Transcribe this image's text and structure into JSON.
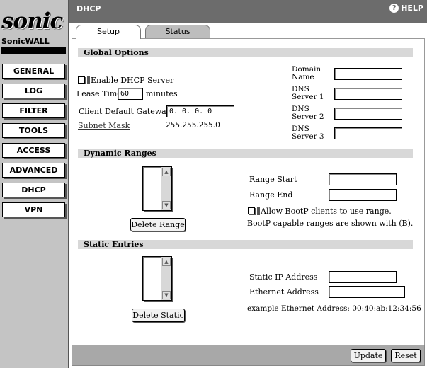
{
  "sidebar": {
    "logo": "sonic",
    "brand": "SonicWALL",
    "items": [
      {
        "id": "general",
        "label": "GENERAL"
      },
      {
        "id": "log",
        "label": "LOG"
      },
      {
        "id": "filter",
        "label": "FILTER"
      },
      {
        "id": "tools",
        "label": "TOOLS"
      },
      {
        "id": "access",
        "label": "ACCESS"
      },
      {
        "id": "advanced",
        "label": "ADVANCED"
      },
      {
        "id": "dhcp",
        "label": "DHCP"
      },
      {
        "id": "vpn",
        "label": "VPN"
      }
    ]
  },
  "header": {
    "title": "DHCP",
    "help_label": "HELP",
    "help_icon": "?"
  },
  "tabs": [
    {
      "label": "Setup"
    },
    {
      "label": "Status"
    }
  ],
  "global_options": {
    "title": "Global Options",
    "enable_dhcp_label": "Enable DHCP Server",
    "enable_dhcp_checked": false,
    "lease_time_label": "Lease Time",
    "lease_time_value": "60",
    "lease_time_unit": "minutes",
    "gateway_label": "Client Default Gateway",
    "gateway_value": "0. 0. 0. 0",
    "subnet_label": "Subnet Mask",
    "subnet_value": "255.255.255.0",
    "domain_name_label": "Domain Name",
    "dns1_label": "DNS Server 1",
    "dns2_label": "DNS Server 2",
    "dns3_label": "DNS Server 3",
    "domain_name_value": "",
    "dns1_value": "",
    "dns2_value": "",
    "dns3_value": ""
  },
  "dynamic_ranges": {
    "title": "Dynamic Ranges",
    "delete_button": "Delete Range",
    "range_start_label": "Range Start",
    "range_end_label": "Range End",
    "range_start_value": "",
    "range_end_value": "",
    "bootp_label": "Allow BootP clients to use range.",
    "bootp_checked": false,
    "bootp_note": "BootP capable ranges are shown with (B)."
  },
  "static_entries": {
    "title": "Static Entries",
    "delete_button": "Delete Static",
    "ip_label": "Static IP Address",
    "mac_label": "Ethernet Address",
    "ip_value": "",
    "mac_value": "",
    "example": "example Ethernet Address: 00:40:ab:12:34:56"
  },
  "footer": {
    "update_button": "Update",
    "reset_button": "Reset"
  }
}
